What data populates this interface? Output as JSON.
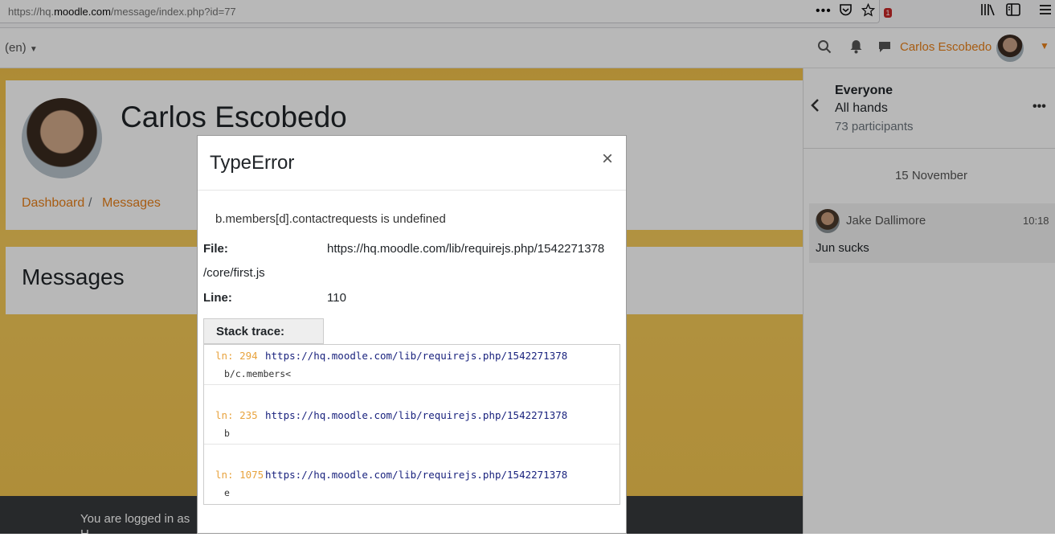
{
  "browser": {
    "url_prefix": "https://hq.",
    "url_domain": "moodle.com",
    "url_path": "/message/index.php?id=77",
    "icons": [
      "more-dots-icon",
      "pocket-icon",
      "star-icon",
      "library-icon",
      "sidebar-icon",
      "hamburger-icon"
    ]
  },
  "navbar": {
    "language": "(en)",
    "notification_count": "1",
    "user_name": "Carlos Escobedo"
  },
  "profile": {
    "name": "Carlos Escobedo",
    "breadcrumb": [
      "Dashboard",
      "Messages"
    ],
    "breadcrumb_sep": "/"
  },
  "messages_heading": "Messages",
  "footer": {
    "logged_in_text": "You are logged in as",
    "line2": "H"
  },
  "drawer": {
    "title": "Everyone",
    "conversation": "All hands",
    "participants": "73 participants",
    "date": "15 November",
    "message": {
      "sender": "Jake Dallimore",
      "time": "10:18",
      "text": "Jun sucks"
    }
  },
  "modal": {
    "title": "TypeError",
    "close": "×",
    "error_message": "b.members[d].contactrequests is undefined",
    "file_label": "File:",
    "file_value": "https://hq.moodle.com/lib/requirejs.php/1542271378",
    "file_value_cont": "/core/first.js",
    "line_label": "Line:",
    "line_value": "110",
    "stack_label": "Stack trace:",
    "stack": [
      {
        "ln": "ln: 294 ",
        "url": "https://hq.moodle.com/lib/requirejs.php/1542271378",
        "fn": "b/c.members<"
      },
      {
        "ln": "ln: 235 ",
        "url": "https://hq.moodle.com/lib/requirejs.php/1542271378",
        "fn": "b"
      },
      {
        "ln": "ln: 1075",
        "url": "https://hq.moodle.com/lib/requirejs.php/1542271378",
        "fn": "e"
      }
    ]
  }
}
